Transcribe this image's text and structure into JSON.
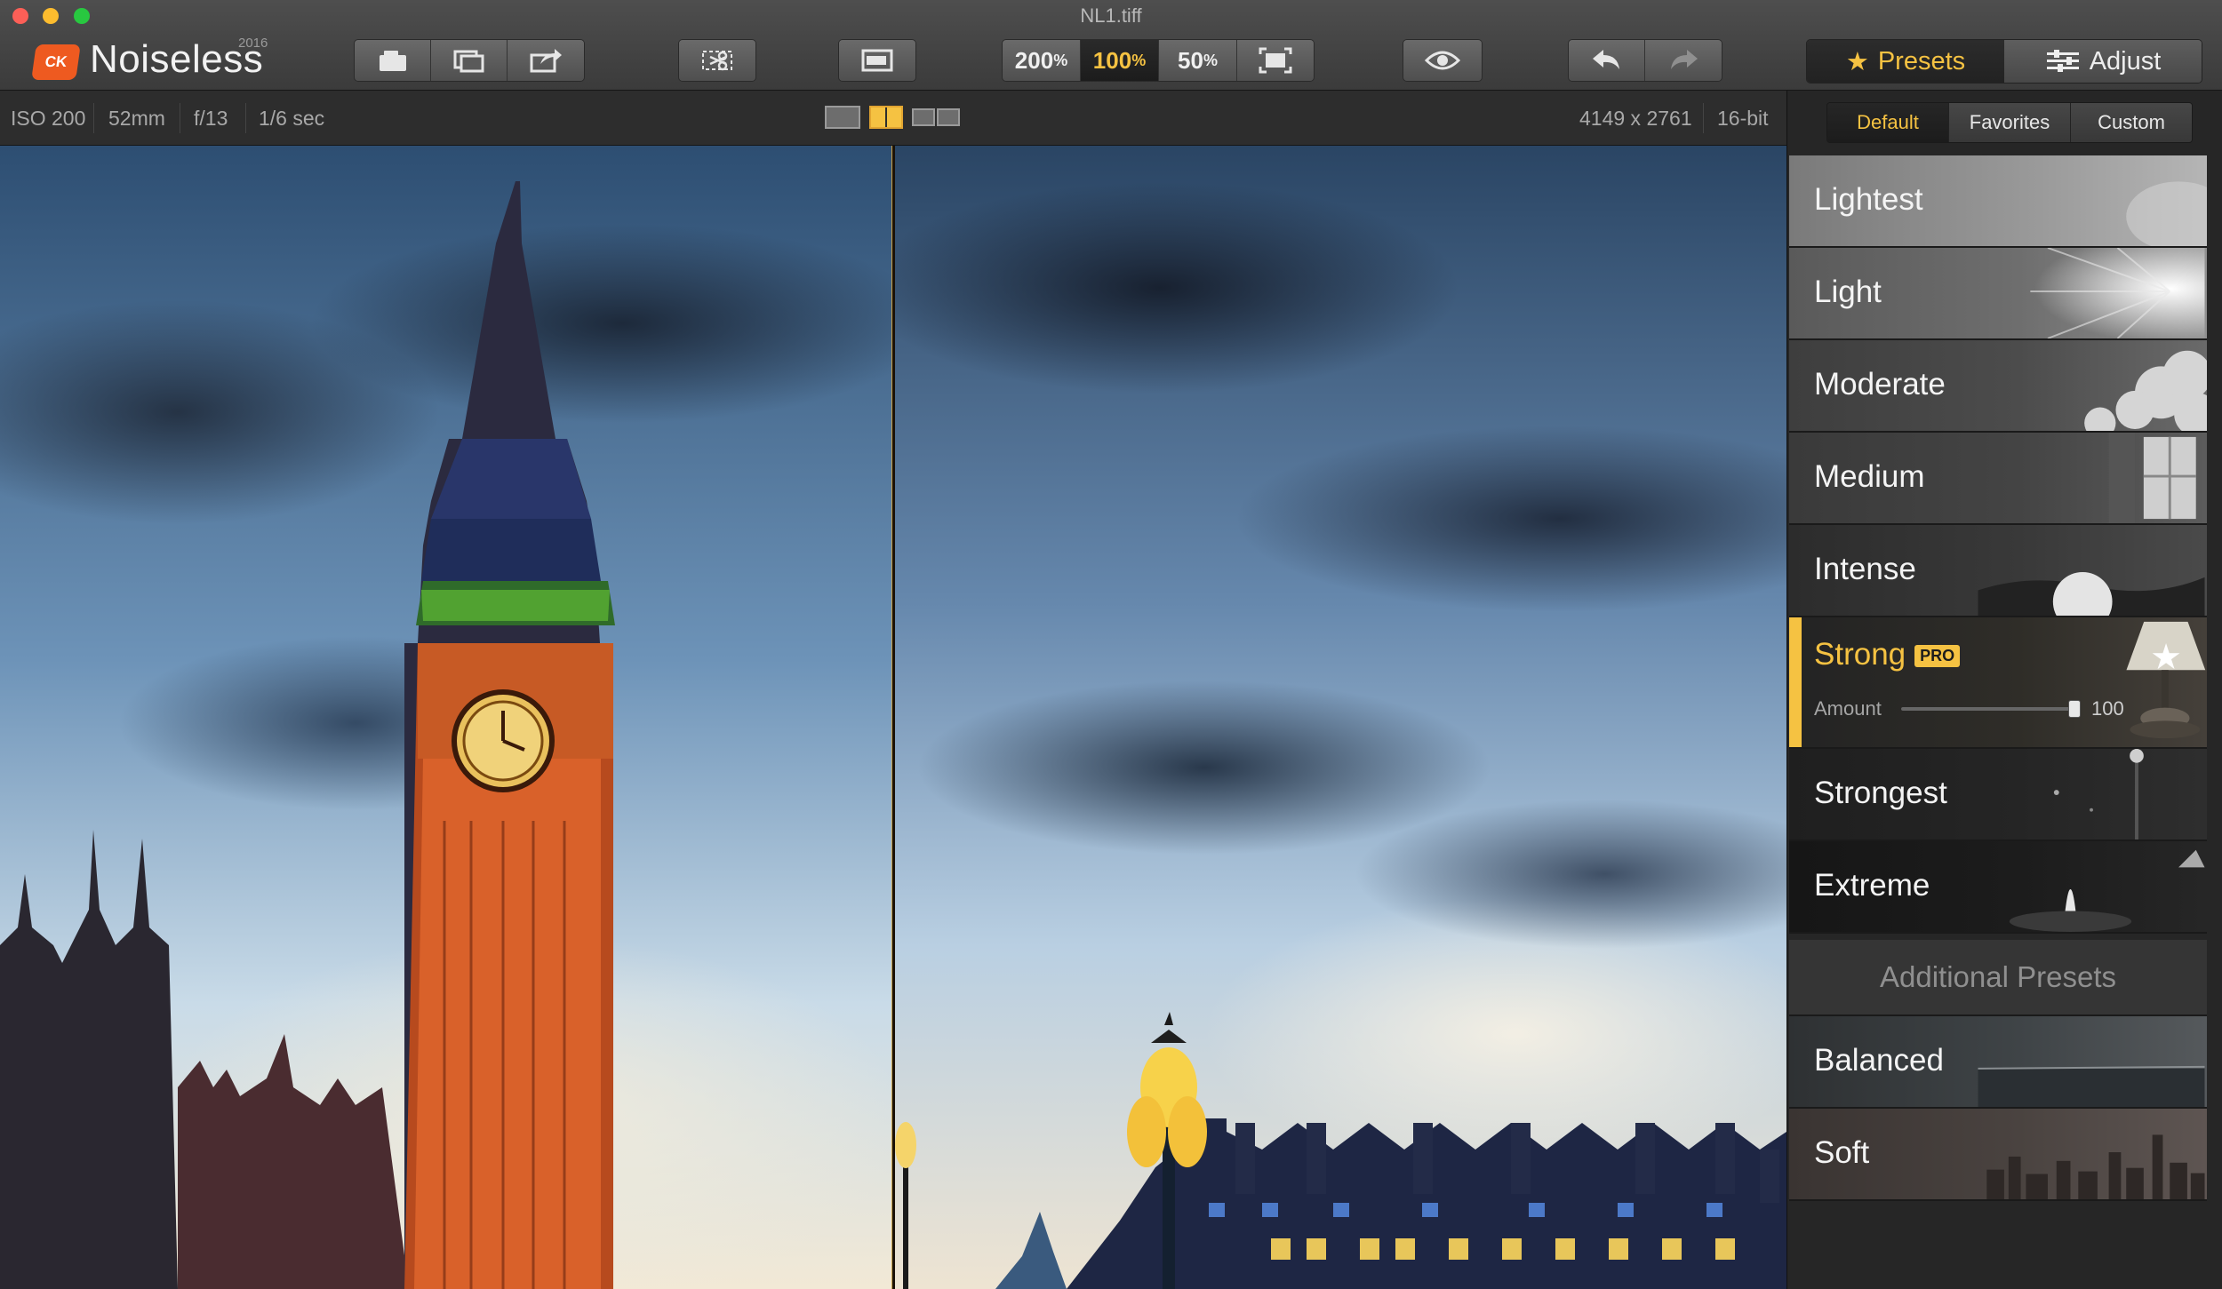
{
  "window": {
    "title": "NL1.tiff"
  },
  "app": {
    "badge": "CK",
    "name": "Noiseless",
    "year": "2016"
  },
  "toolbar": {
    "file_buttons": [
      "open-icon",
      "batch-icon",
      "export-icon"
    ],
    "crop_icon": "crop-scissors-icon",
    "compare_icon": "compare-window-icon",
    "zoom": [
      {
        "value": "200",
        "unit": "%"
      },
      {
        "value": "100",
        "unit": "%"
      },
      {
        "value": "50",
        "unit": "%"
      }
    ],
    "zoom_selected": "100",
    "fit_icon": "fit-screen-icon",
    "preview_icon": "eye-icon",
    "undo_icon": "undo-arrow-icon",
    "redo_icon": "redo-arrow-icon"
  },
  "tabs": [
    {
      "label": "Presets",
      "icon": "star-icon",
      "active": true
    },
    {
      "label": "Adjust",
      "icon": "sliders-icon",
      "active": false
    }
  ],
  "info": {
    "iso": "ISO 200",
    "focal": "52mm",
    "aperture": "f/13",
    "shutter": "1/6 sec",
    "dimensions": "4149 x 2761",
    "bit_depth": "16-bit"
  },
  "preset_filters": [
    {
      "label": "Default",
      "active": true
    },
    {
      "label": "Favorites",
      "active": false
    },
    {
      "label": "Custom",
      "active": false
    }
  ],
  "presets": [
    {
      "label": "Lightest"
    },
    {
      "label": "Light"
    },
    {
      "label": "Moderate"
    },
    {
      "label": "Medium"
    },
    {
      "label": "Intense"
    },
    {
      "label": "Strong",
      "badge": "PRO",
      "selected": true,
      "favorite": true,
      "amount_label": "Amount",
      "amount": "100",
      "amount_fraction": 1.0
    },
    {
      "label": "Strongest"
    },
    {
      "label": "Extreme"
    }
  ],
  "additional_header": "Additional Presets",
  "additional_presets": [
    {
      "label": "Balanced"
    },
    {
      "label": "Soft"
    }
  ],
  "colors": {
    "accent": "#f5c242",
    "logo": "#ee5a20"
  }
}
